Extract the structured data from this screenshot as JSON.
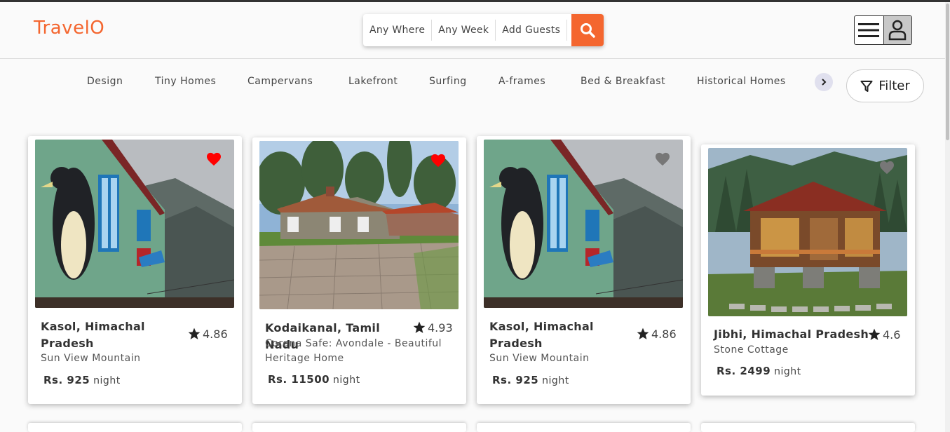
{
  "app": {
    "logo": "TravelO"
  },
  "search": {
    "where": "Any Where",
    "week": "Any Week",
    "guests": "Add Guests"
  },
  "categories": [
    "Design",
    "Tiny Homes",
    "Campervans",
    "Lakefront",
    "Surfing",
    "A-frames",
    "Bed & Breakfast",
    "Historical Homes"
  ],
  "filter_label": "Filter",
  "listings": [
    {
      "title": "Kasol, Himachal Pradesh",
      "rating": "4.86",
      "subtitle": "Sun View Mountain",
      "price": "Rs. 925",
      "unit": "night",
      "favorite": true,
      "heart_color": "#ff0000"
    },
    {
      "title": "Kodaikanal, Tamil Nadu",
      "rating": "4.93",
      "subtitle": "Corona Safe: Avondale - Beautiful Heritage Home",
      "price": "Rs. 11500",
      "unit": "night",
      "favorite": true,
      "heart_color": "#ff0000"
    },
    {
      "title": "Kasol, Himachal Pradesh",
      "rating": "4.86",
      "subtitle": "Sun View Mountain",
      "price": "Rs. 925",
      "unit": "night",
      "favorite": false,
      "heart_color": "#777777"
    },
    {
      "title": "Jibhi, Himachal Pradesh",
      "rating": "4.6",
      "subtitle": "Stone Cottage",
      "price": "Rs. 2499",
      "unit": "night",
      "favorite": false,
      "heart_color": "#777777"
    }
  ],
  "colors": {
    "accent": "#f4662f"
  }
}
